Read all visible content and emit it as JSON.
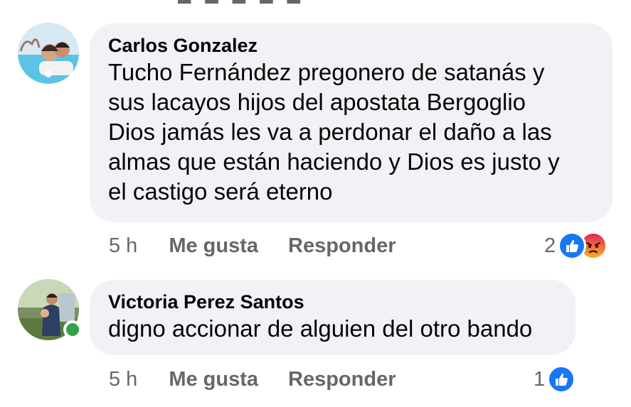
{
  "comments": [
    {
      "author": "Carlos Gonzalez",
      "text_lines": [
        "Tucho Fernández pregonero de satanás y",
        "sus lacayos hijos del apostata Bergoglio",
        "Dios jamás les va a perdonar el daño a las",
        "almas que están haciendo y Dios es justo y",
        "el castigo será eterno"
      ],
      "time": "5 h",
      "like_label": "Me gusta",
      "reply_label": "Responder",
      "reaction_count": "2",
      "reactions": [
        "like-icon",
        "angry-icon"
      ],
      "online": false
    },
    {
      "author": "Victoria Perez Santos",
      "text_lines": [
        "digno accionar de alguien del otro bando"
      ],
      "time": "5 h",
      "like_label": "Me gusta",
      "reply_label": "Responder",
      "reaction_count": "1",
      "reactions": [
        "like-icon"
      ],
      "online": true
    }
  ],
  "colors": {
    "bubble": "#f0f2f5",
    "secondary_text": "#65676b",
    "like_blue": "#1877f2",
    "angry_orange": "#f0522c",
    "online_green": "#31a24c"
  }
}
